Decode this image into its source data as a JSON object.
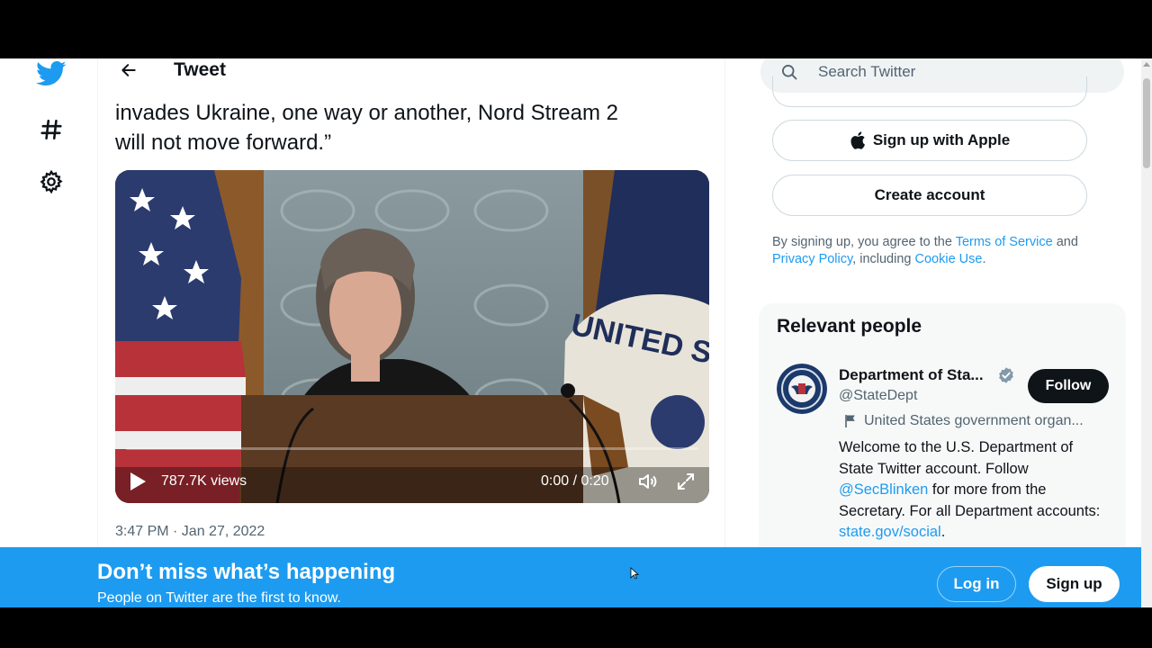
{
  "colors": {
    "brand": "#1d9bf0",
    "text": "#0f1419",
    "muted": "#536471",
    "follow_bg": "#0f1419"
  },
  "nav": {
    "logo_icon": "twitter-bird-icon",
    "explore_icon": "hashtag-icon",
    "settings_icon": "gear-icon"
  },
  "header": {
    "back_icon": "arrow-left-icon",
    "title": "Tweet"
  },
  "tweet": {
    "text_line1": "invades Ukraine, one way or another, Nord Stream 2",
    "text_line2": "will not move forward.”",
    "video": {
      "views": "787.7K views",
      "time": "0:00 / 0:20",
      "progress": 0
    },
    "timestamp": "3:47 PM · Jan 27, 2022"
  },
  "search": {
    "placeholder": "Search Twitter"
  },
  "signup": {
    "apple_label": "Sign up with Apple",
    "create_label": "Create account",
    "legal_prefix": "By signing up, you agree to the ",
    "terms_link": "Terms of Service",
    "legal_and": " and",
    "privacy_link": "Privacy Policy",
    "legal_including": ", including ",
    "cookie_link": "Cookie Use",
    "legal_end": "."
  },
  "relevant_people": {
    "title": "Relevant people",
    "person": {
      "name": "Department of Sta...",
      "handle": "@StateDept",
      "follow_label": "Follow",
      "label": "United States government organ...",
      "bio_part1": "Welcome to the U.S. Department of State Twitter account. Follow ",
      "bio_mention": "@SecBlinken",
      "bio_part2": " for more from the Secretary. For all Department accounts: ",
      "bio_link": "state.gov/social",
      "bio_end": "."
    }
  },
  "banner": {
    "title": "Don’t miss what’s happening",
    "subtitle": "People on Twitter are the first to know.",
    "login_label": "Log in",
    "signup_label": "Sign up"
  }
}
